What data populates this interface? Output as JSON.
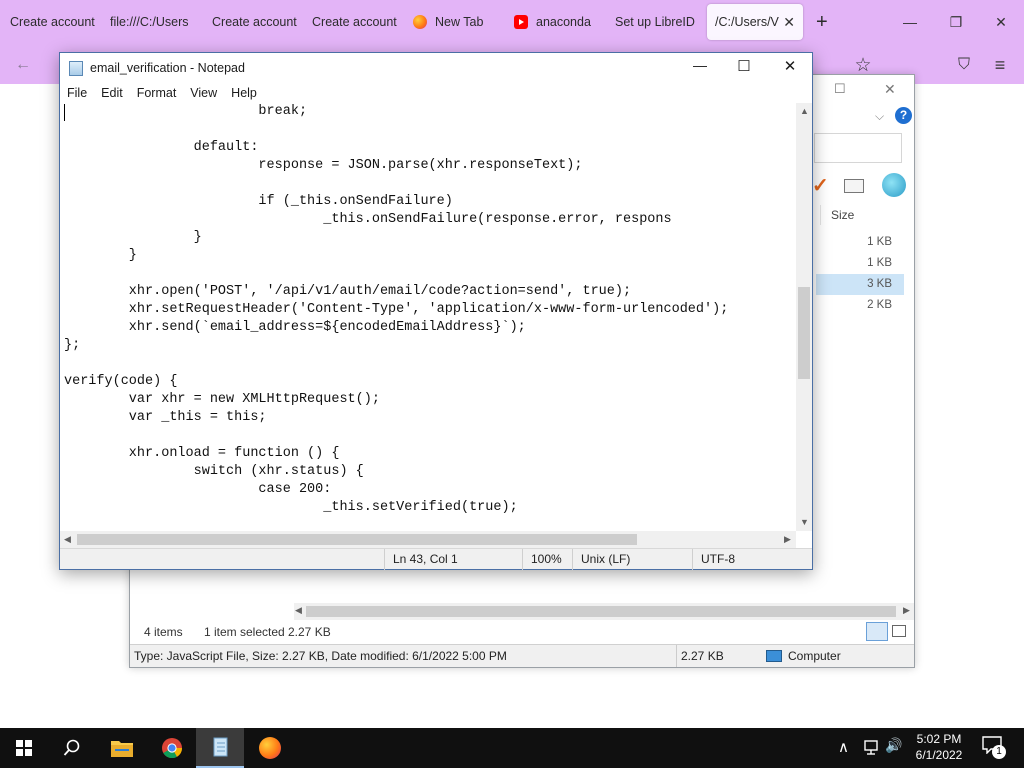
{
  "browser": {
    "tabs": [
      {
        "label": "Create account",
        "icon": "none"
      },
      {
        "label": "file:///C:/Users",
        "icon": "none"
      },
      {
        "label": "Create account",
        "icon": "none"
      },
      {
        "label": "Create account",
        "icon": "none"
      },
      {
        "label": "New Tab",
        "icon": "firefox-icon"
      },
      {
        "label": "anaconda",
        "icon": "youtube-icon"
      },
      {
        "label": "Set up LibreID",
        "icon": "none"
      },
      {
        "label": "/C:/Users/V",
        "icon": "none",
        "active": true
      }
    ],
    "new_tab_symbol": "+",
    "window_controls": {
      "minimize": "—",
      "restore": "❐",
      "close": "✕"
    },
    "toolbar": {
      "back": "←",
      "bookmark_star": "☆",
      "pocket": "⛉",
      "menu": "≡"
    }
  },
  "explorer": {
    "controls": {
      "restore": "☐",
      "close": "✕"
    },
    "chevron": "⌵",
    "help": "?",
    "column_size_header": "Size",
    "file_sizes": [
      "1 KB",
      "1 KB",
      "3 KB",
      "2 KB"
    ],
    "selected_index": 2,
    "status": {
      "items": "4 items",
      "selected": "1 item selected",
      "selected_size": "2.27 KB"
    },
    "details_bar": {
      "description": "Type: JavaScript File, Size: 2.27 KB, Date modified: 6/1/2022 5:00 PM",
      "size": "2.27 KB",
      "location": "Computer"
    }
  },
  "notepad": {
    "title": "email_verification - Notepad",
    "controls": {
      "minimize": "—",
      "maximize": "☐",
      "close": "✕"
    },
    "menu": [
      "File",
      "Edit",
      "Format",
      "View",
      "Help"
    ],
    "code_lines": [
      "                        break;",
      "",
      "                default:",
      "                        response = JSON.parse(xhr.responseText);",
      "",
      "                        if (_this.onSendFailure)",
      "                                _this.onSendFailure(response.error, respons",
      "                }",
      "        }",
      "",
      "        xhr.open('POST', '/api/v1/auth/email/code?action=send', true);",
      "        xhr.setRequestHeader('Content-Type', 'application/x-www-form-urlencoded');",
      "        xhr.send(`email_address=${encodedEmailAddress}`);",
      "};",
      "",
      "verify(code) {",
      "        var xhr = new XMLHttpRequest();",
      "        var _this = this;",
      "",
      "        xhr.onload = function () {",
      "                switch (xhr.status) {",
      "                        case 200:",
      "                                _this.setVerified(true);"
    ],
    "status": {
      "position": "Ln 43, Col 1",
      "zoom": "100%",
      "line_endings": "Unix (LF)",
      "encoding": "UTF-8"
    }
  },
  "taskbar": {
    "apps": [
      {
        "name": "start-button",
        "icon": "windows-logo-icon"
      },
      {
        "name": "search-button",
        "icon": "search-icon"
      },
      {
        "name": "file-explorer",
        "icon": "folder-icon"
      },
      {
        "name": "chrome",
        "icon": "chrome-icon"
      },
      {
        "name": "notepad",
        "icon": "notepad-icon",
        "active": true
      },
      {
        "name": "firefox",
        "icon": "firefox-icon"
      }
    ],
    "clock": {
      "time": "5:02 PM",
      "date": "6/1/2022"
    },
    "notifications_count": "1",
    "tray": {
      "chevron": "∧",
      "volume": "🔊"
    }
  }
}
